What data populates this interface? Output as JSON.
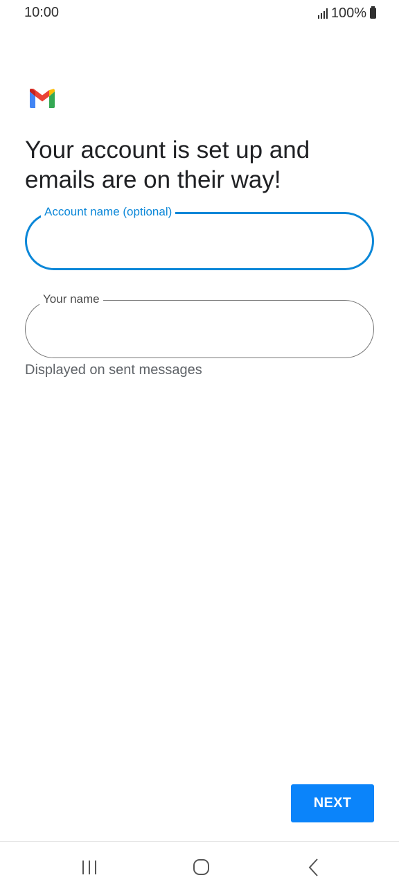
{
  "status_bar": {
    "time": "10:00",
    "battery_text": "100%"
  },
  "app": {
    "logo_icon": "gmail-logo"
  },
  "page": {
    "headline": "Your account is set up and emails are on their way!"
  },
  "form": {
    "account_name": {
      "label": "Account name (optional)",
      "value": "",
      "state": "focused"
    },
    "your_name": {
      "label": "Your name",
      "value": "",
      "helper": "Displayed on sent messages"
    }
  },
  "actions": {
    "next_label": "NEXT"
  },
  "nav_bar": {
    "recents_icon": "recents-icon",
    "home_icon": "home-icon",
    "back_icon": "back-icon"
  },
  "colors": {
    "accent": "#0b87d8",
    "button": "#0b84fa",
    "text": "#202124",
    "helper_text": "#5f6368"
  }
}
